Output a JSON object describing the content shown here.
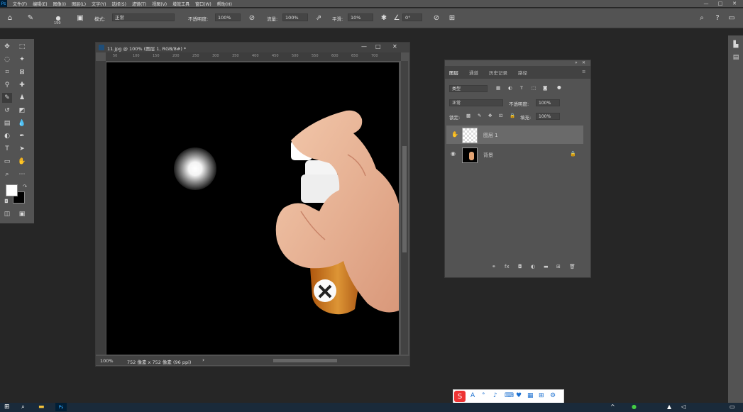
{
  "menubar": {
    "logo": "Ps",
    "items": [
      "文件(F)",
      "编辑(E)",
      "图像(I)",
      "图层(L)",
      "文字(Y)",
      "选择(S)",
      "滤镜(T)",
      "视图(V)",
      "增效工具",
      "窗口(W)",
      "帮助(H)"
    ],
    "minimize": "—",
    "maximize": "□",
    "close": "✕"
  },
  "options": {
    "brush_size": "150",
    "mode_label": "模式:",
    "mode_value": "正常",
    "opacity_label": "不透明度:",
    "opacity_value": "100%",
    "flow_label": "流量:",
    "flow_value": "100%",
    "smooth_label": "平滑:",
    "smooth_value": "10%",
    "angle_value": "0°"
  },
  "document": {
    "title": "11.jpg @ 100% (图层 1, RGB/8#) *",
    "zoom": "100%",
    "status": "752 像素 x 752 像素 (96 ppi)",
    "ruler_ticks": [
      "50",
      "100",
      "150",
      "200",
      "250",
      "300",
      "350",
      "400",
      "450",
      "500",
      "550",
      "600",
      "650",
      "700"
    ]
  },
  "layers_panel": {
    "tabs": [
      "图层",
      "通道",
      "历史记录",
      "路径"
    ],
    "filter_label": "类型",
    "blend_mode": "正常",
    "opacity_label": "不透明度:",
    "opacity_value": "100%",
    "lock_label": "锁定:",
    "fill_label": "填充:",
    "fill_value": "100%",
    "layers": [
      {
        "name": "图层 1"
      },
      {
        "name": "背景"
      }
    ]
  },
  "colors": {
    "panel": "#535353",
    "background": "#262626",
    "canvas": "#000000"
  }
}
